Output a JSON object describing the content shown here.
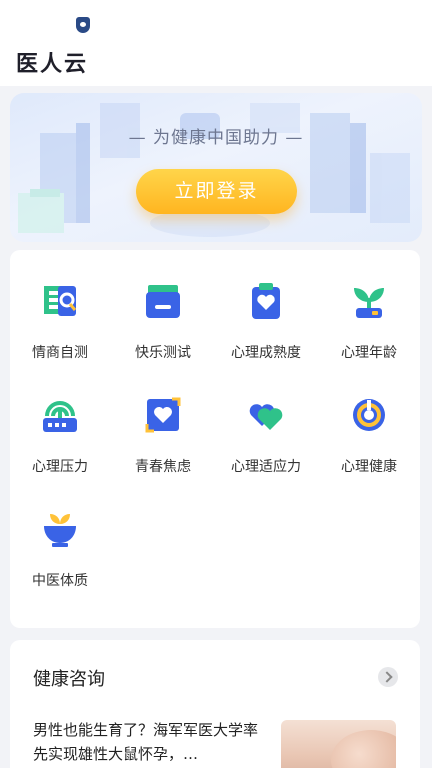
{
  "app": {
    "title": "医人云"
  },
  "banner": {
    "slogan": "— 为健康中国助力 —",
    "login_label": "立即登录"
  },
  "tests": [
    {
      "label": "情商自测",
      "icon": "eq-icon"
    },
    {
      "label": "快乐测试",
      "icon": "inbox-icon"
    },
    {
      "label": "心理成熟度",
      "icon": "heart-clipboard-icon"
    },
    {
      "label": "心理年龄",
      "icon": "sprout-icon"
    },
    {
      "label": "心理压力",
      "icon": "pressure-gauge-icon"
    },
    {
      "label": "青春焦虑",
      "icon": "heart-frame-icon"
    },
    {
      "label": "心理适应力",
      "icon": "double-heart-icon"
    },
    {
      "label": "心理健康",
      "icon": "ring-icon"
    },
    {
      "label": "中医体质",
      "icon": "herb-bowl-icon"
    }
  ],
  "news": {
    "title": "健康咨询",
    "article": "男性也能生育了？海军军医大学率先实现雄性大鼠怀孕，…"
  },
  "colors": {
    "brand_blue": "#3a63e6",
    "accent_yellow": "#ffc238",
    "accent_green": "#31c48d"
  }
}
